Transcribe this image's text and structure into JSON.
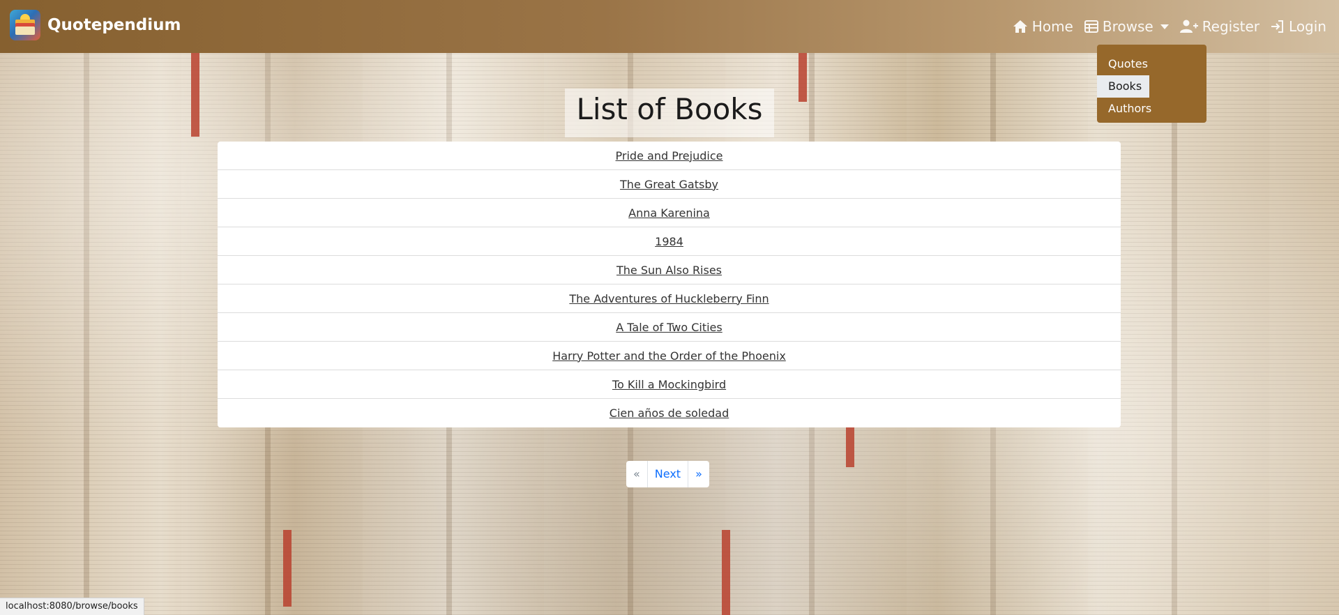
{
  "navbar": {
    "brand_name": "Quotependium",
    "links": {
      "home": "Home",
      "browse": "Browse",
      "register": "Register",
      "login": "Login"
    },
    "icons": {
      "home": "house-icon",
      "browse": "table-icon",
      "register": "person-plus-icon",
      "login": "login-arrow-icon"
    }
  },
  "browse_dropdown": {
    "items": [
      {
        "label": "Quotes",
        "active": false
      },
      {
        "label": "Books",
        "active": true
      },
      {
        "label": "Authors",
        "active": false
      }
    ]
  },
  "main": {
    "title": "List of Books",
    "books": [
      "Pride and Prejudice",
      "The Great Gatsby",
      "Anna Karenina",
      "1984",
      "The Sun Also Rises",
      "The Adventures of Huckleberry Finn",
      "A Tale of Two Cities",
      "Harry Potter and the Order of the Phoenix",
      "To Kill a Mockingbird",
      "Cien años de soledad"
    ]
  },
  "pagination": {
    "first": "«",
    "next": "Next",
    "last": "»"
  },
  "status_bar": {
    "url": "localhost:8080/browse/books"
  },
  "colors": {
    "navbar": "#8a6133",
    "dropdown_bg": "#96682b",
    "link_blue": "#0d6efd"
  }
}
